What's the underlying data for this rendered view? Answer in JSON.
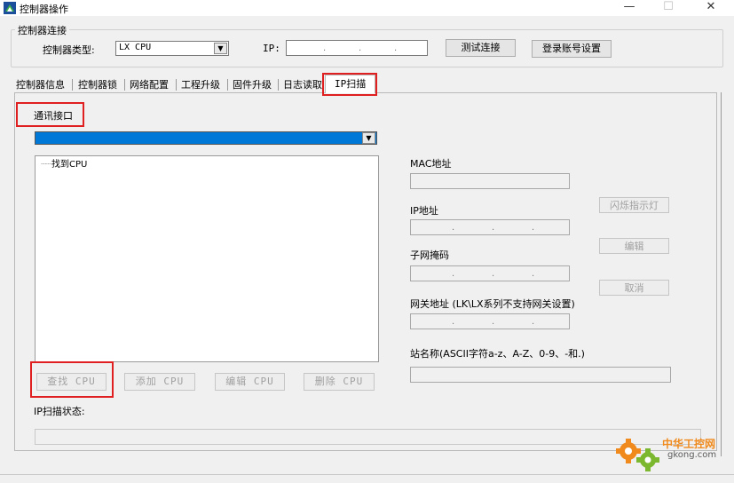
{
  "window": {
    "title": "控制器操作",
    "minimize_glyph": "—",
    "maximize_glyph": "☐",
    "close_glyph": "✕",
    "app_icon": "app-logo-icon"
  },
  "connection": {
    "group_title": "控制器连接",
    "type_label": "控制器类型:",
    "type_value": "LX CPU",
    "ip_label": "IP:",
    "ip_dots": [
      ".",
      ".",
      "."
    ],
    "test_button": "测试连接",
    "login_button": "登录账号设置"
  },
  "tabs": [
    {
      "label": "控制器信息"
    },
    {
      "label": "控制器锁"
    },
    {
      "label": "网络配置"
    },
    {
      "label": "工程升级"
    },
    {
      "label": "固件升级"
    },
    {
      "label": "日志读取"
    },
    {
      "label": "IP扫描"
    }
  ],
  "scan": {
    "interface_label": "通讯接口",
    "tree_item": "找到CPU",
    "find_button": "查找 CPU",
    "add_button": "添加 CPU",
    "edit_button": "编辑 CPU",
    "delete_button": "删除 CPU",
    "status_label": "IP扫描状态:"
  },
  "details": {
    "mac_label": "MAC地址",
    "ip_label": "IP地址",
    "subnet_label": "子网掩码",
    "gateway_label": "网关地址 (LK\\LX系列不支持网关设置)",
    "station_label": "站名称(ASCII字符a-z、A-Z、0-9、-和.)",
    "blink_button": "闪烁指示灯",
    "edit_button": "编辑",
    "cancel_button": "取消",
    "ip_dots": [
      ".",
      ".",
      "."
    ],
    "subnet_dots": [
      ".",
      ".",
      "."
    ],
    "gateway_dots": [
      ".",
      ".",
      "."
    ]
  },
  "watermark": {
    "text_cn": "中华工控网",
    "text_url": "gkong.com"
  },
  "colors": {
    "selection_blue": "#0078d7",
    "highlight_red": "#e02020",
    "watermark_orange": "#f08a1c",
    "watermark_green": "#7cb82f"
  }
}
